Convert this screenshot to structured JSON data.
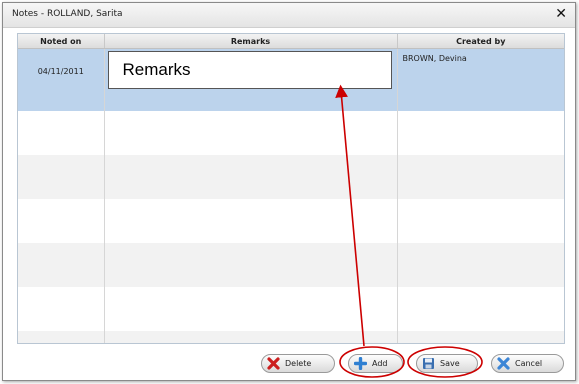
{
  "dialog": {
    "title": "Notes - ROLLAND, Sarita",
    "close_glyph": "✕"
  },
  "grid": {
    "columns": [
      "Noted on",
      "Remarks",
      "Created by"
    ],
    "rows": [
      {
        "noted_on": "04/11/2011",
        "remarks": "Remarks",
        "created_by": "BROWN, Devina"
      }
    ]
  },
  "buttons": {
    "delete": {
      "label": "Delete",
      "icon": "red-x-icon",
      "color": "#cc1f1f"
    },
    "add": {
      "label": "Add",
      "icon": "blue-plus-icon",
      "color": "#2f7fd1"
    },
    "save": {
      "label": "Save",
      "icon": "floppy-disk-icon",
      "color": "#3a6fb0"
    },
    "cancel": {
      "label": "Cancel",
      "icon": "blue-x-icon",
      "color": "#3d86d6"
    }
  },
  "annotations": {
    "highlight_color": "#cc0000",
    "highlighted": [
      "add-button",
      "save-button",
      "remarks-input"
    ]
  }
}
